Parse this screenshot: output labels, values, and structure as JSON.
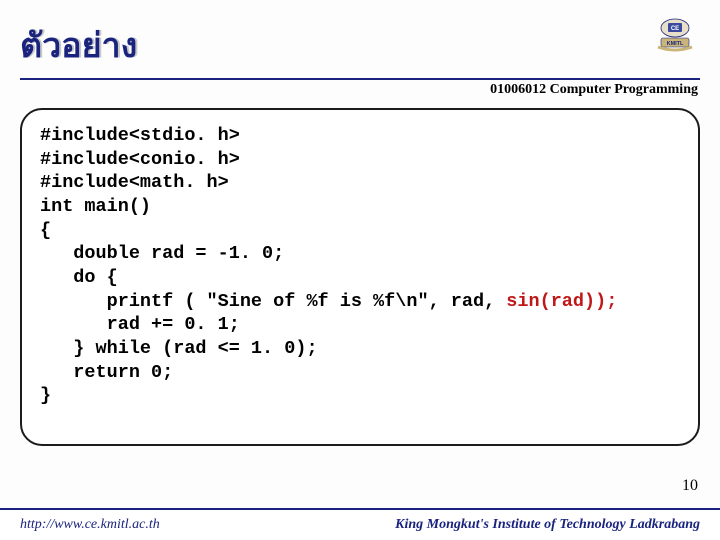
{
  "header": {
    "title": "ตัวอย่าง",
    "course": "01006012 Computer Programming"
  },
  "code": {
    "lines": [
      "#include<stdio. h>",
      "#include<conio. h>",
      "#include<math. h>",
      "int main()",
      "{",
      "   double rad = -1. 0;",
      "   do {",
      "      printf ( \"Sine of %f is %f\\n\", rad, ",
      "      rad += 0. 1;",
      "   } while (rad <= 1. 0);",
      "   return 0;",
      "}"
    ],
    "red_fragment": "sin(rad));"
  },
  "page": "10",
  "footer": {
    "left": "http://www.ce.kmitl.ac.th",
    "right": "King Mongkut's Institute of Technology Ladkrabang"
  }
}
